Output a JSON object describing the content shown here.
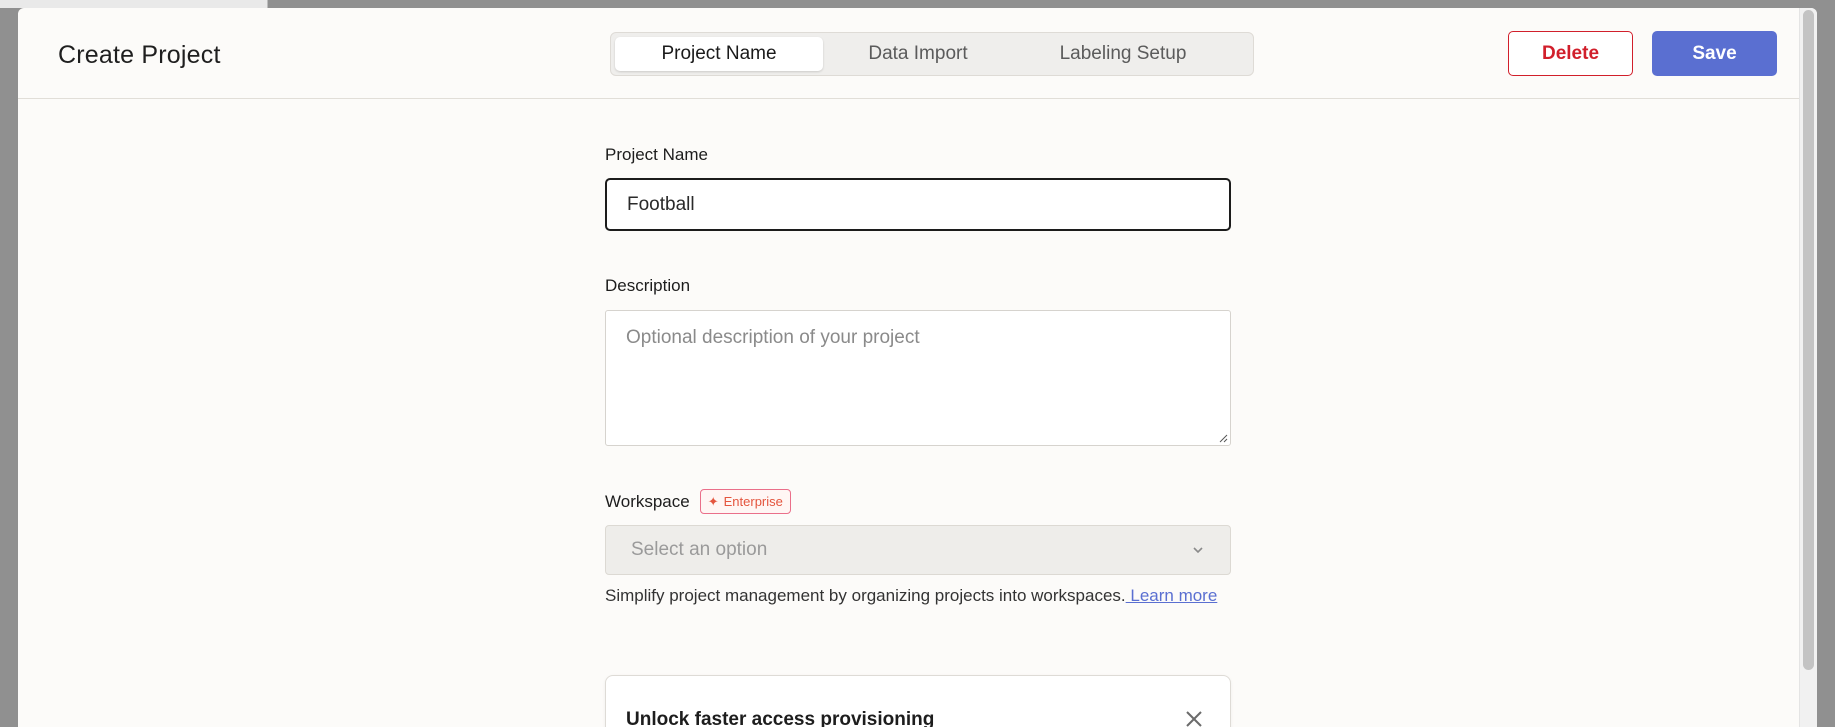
{
  "modal": {
    "title": "Create Project",
    "tabs": [
      {
        "label": "Project Name",
        "active": true
      },
      {
        "label": "Data Import",
        "active": false
      },
      {
        "label": "Labeling Setup",
        "active": false
      }
    ],
    "delete_label": "Delete",
    "save_label": "Save"
  },
  "form": {
    "project_name": {
      "label": "Project Name",
      "value": "Football"
    },
    "description": {
      "label": "Description",
      "placeholder": "Optional description of your project"
    },
    "workspace": {
      "label": "Workspace",
      "badge": "Enterprise",
      "placeholder": "Select an option",
      "help_text": "Simplify project management by organizing projects into workspaces.",
      "learn_more": " Learn more"
    }
  },
  "card": {
    "title": "Unlock faster access provisioning"
  },
  "colors": {
    "accent": "#5a6fd1",
    "danger": "#d11f2b",
    "badge": "#e4553e"
  },
  "icons": [
    "sparkle-icon",
    "chevron-down-icon",
    "close-icon"
  ]
}
